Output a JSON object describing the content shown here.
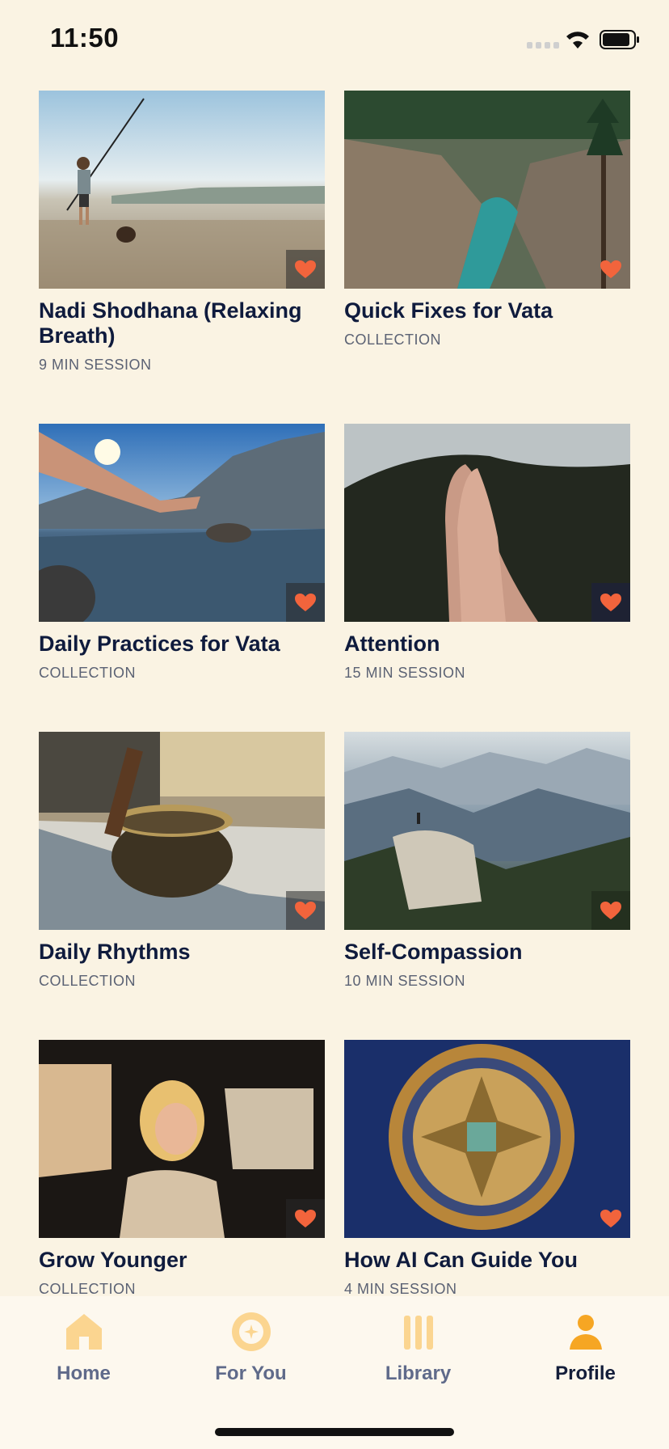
{
  "status": {
    "time": "11:50"
  },
  "cards": [
    {
      "title": "Nadi Shodhana (Relaxing Breath)",
      "subtitle": "9 MIN SESSION",
      "image": "man-fishing-on-beach-with-dog"
    },
    {
      "title": "Quick Fixes for Vata",
      "subtitle": "COLLECTION",
      "image": "river-canyon-with-pines"
    },
    {
      "title": "Daily Practices for Vata",
      "subtitle": "COLLECTION",
      "image": "hand-over-mountain-lake"
    },
    {
      "title": "Attention",
      "subtitle": "15 MIN SESSION",
      "image": "hands-in-prayer"
    },
    {
      "title": "Daily Rhythms",
      "subtitle": "COLLECTION",
      "image": "singing-bowl"
    },
    {
      "title": "Self-Compassion",
      "subtitle": "10 MIN SESSION",
      "image": "person-on-rock-mountains"
    },
    {
      "title": "Grow Younger",
      "subtitle": "COLLECTION",
      "image": "woman-in-car-sunlight"
    },
    {
      "title": "How AI Can Guide You",
      "subtitle": "4 MIN SESSION",
      "image": "golden-mandala-circuit"
    }
  ],
  "tabs": [
    {
      "label": "Home",
      "icon": "home-icon"
    },
    {
      "label": "For You",
      "icon": "for-you-icon"
    },
    {
      "label": "Library",
      "icon": "library-icon"
    },
    {
      "label": "Profile",
      "icon": "profile-icon",
      "active": true
    }
  ],
  "colors": {
    "background": "#faf3e3",
    "heart": "#f2643c",
    "tab_icon": "#fbd590",
    "tab_icon_active": "#f6a623"
  }
}
